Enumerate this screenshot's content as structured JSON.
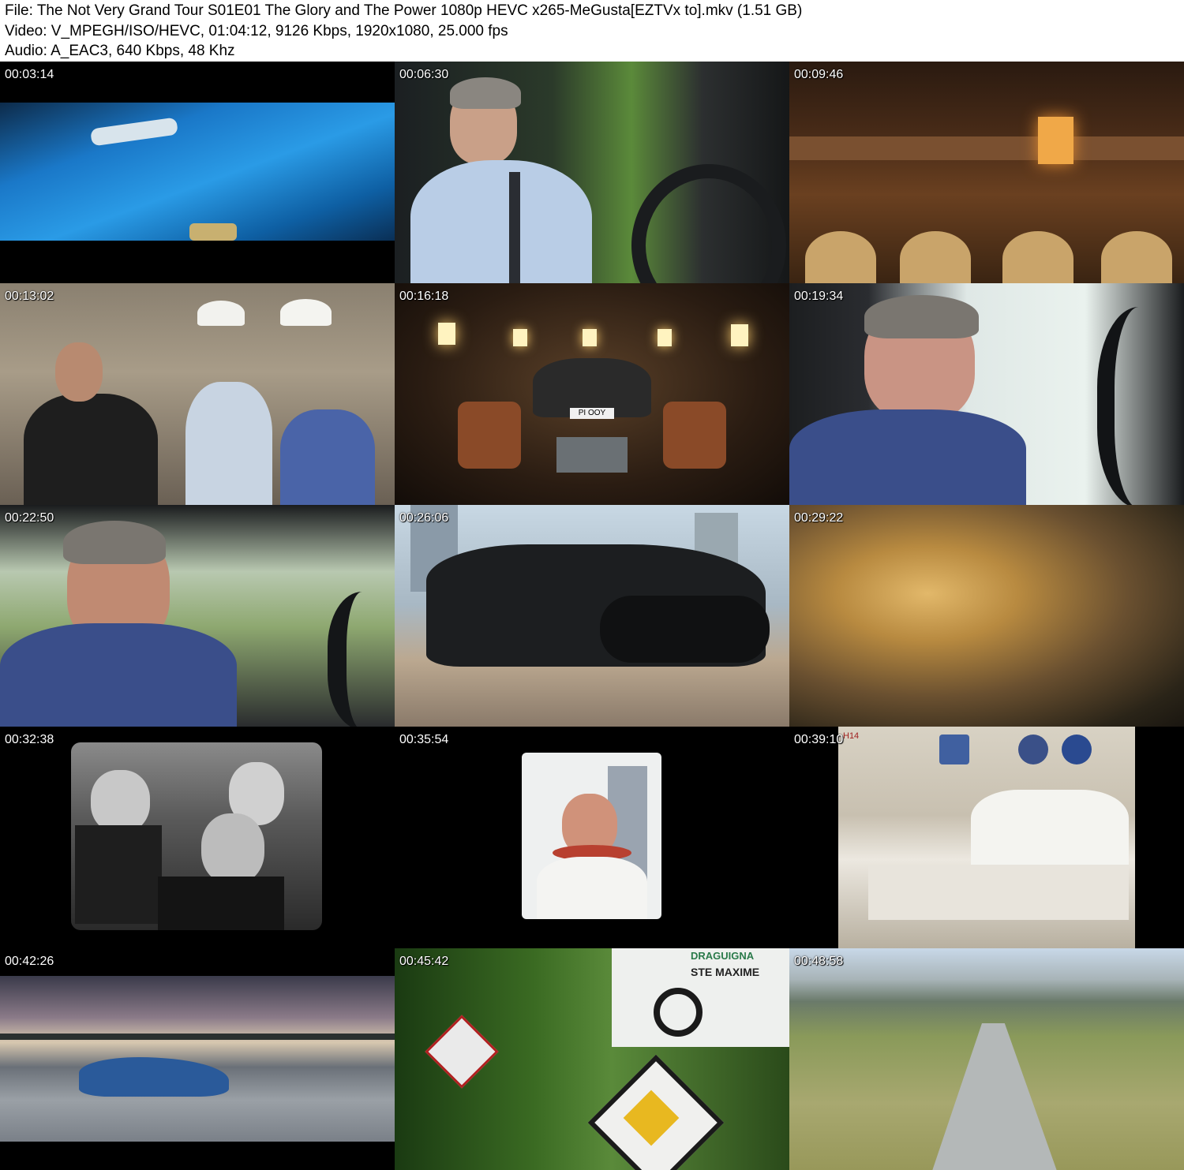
{
  "header": {
    "file_line": "File: The Not Very Grand Tour S01E01 The Glory and The Power 1080p HEVC x265-MeGusta[EZTVx to].mkv (1.51 GB)",
    "video_line": "Video: V_MPEGH/ISO/HEVC, 01:04:12, 9126 Kbps, 1920x1080, 25.000 fps",
    "audio_line": "Audio: A_EAC3, 640 Kbps, 48 Khz"
  },
  "thumbnails": [
    {
      "timestamp": "00:03:14"
    },
    {
      "timestamp": "00:06:30"
    },
    {
      "timestamp": "00:09:46"
    },
    {
      "timestamp": "00:13:02"
    },
    {
      "timestamp": "00:16:18"
    },
    {
      "timestamp": "00:19:34"
    },
    {
      "timestamp": "00:22:50"
    },
    {
      "timestamp": "00:26:06"
    },
    {
      "timestamp": "00:29:22"
    },
    {
      "timestamp": "00:32:38"
    },
    {
      "timestamp": "00:35:54"
    },
    {
      "timestamp": "00:39:10"
    },
    {
      "timestamp": "00:42:26"
    },
    {
      "timestamp": "00:45:42"
    },
    {
      "timestamp": "00:48:58"
    }
  ],
  "frame_text": {
    "plate": "PI OOY",
    "sign_top": "DRAGUIGNA",
    "sign_town": "STE MAXIME",
    "wall_label": "H14"
  }
}
